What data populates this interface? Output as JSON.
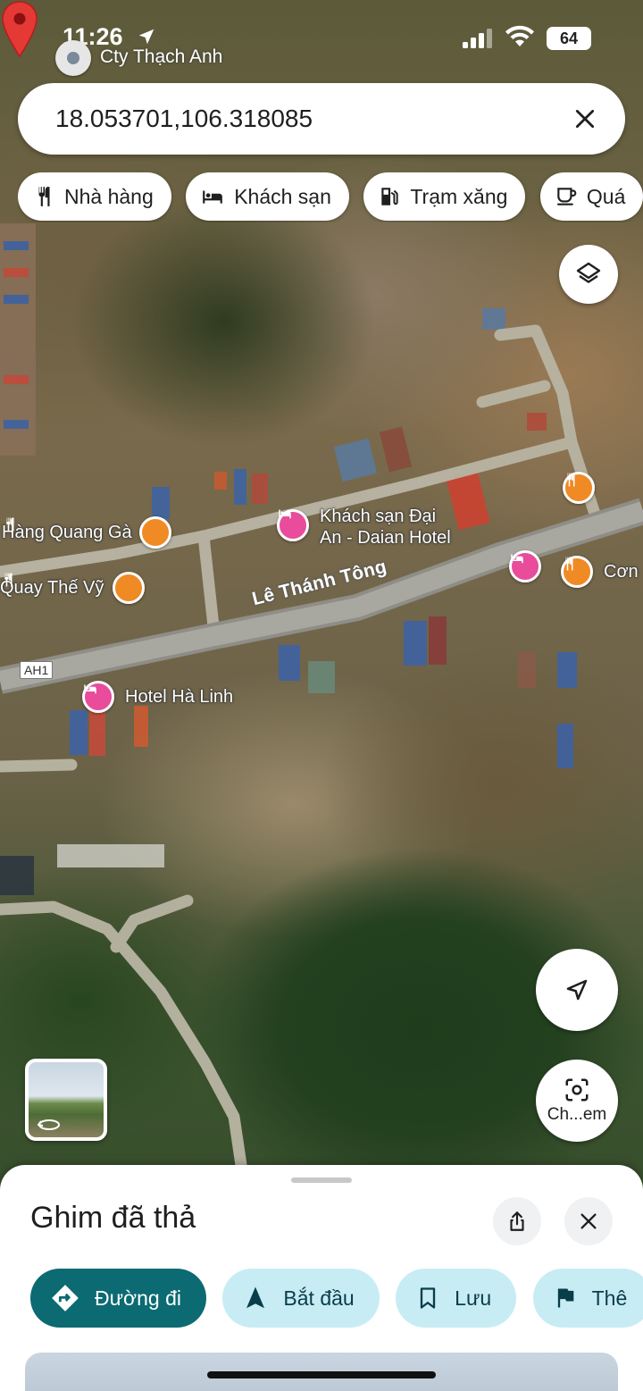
{
  "status_bar": {
    "time": "11:26",
    "carrier": "Cty Thạch Anh",
    "battery": "64"
  },
  "search": {
    "query": "18.053701,106.318085"
  },
  "chips": [
    {
      "label": "Nhà hàng",
      "icon": "restaurant-icon"
    },
    {
      "label": "Khách sạn",
      "icon": "hotel-icon"
    },
    {
      "label": "Trạm xăng",
      "icon": "gas-station-icon"
    },
    {
      "label": "Quá",
      "icon": "cafe-icon"
    }
  ],
  "map": {
    "road_name": "Lê Thánh Tông",
    "highway_shield": "AH1",
    "pois": [
      {
        "label": "Hàng Quang Gà",
        "type": "food"
      },
      {
        "label": "Khách sạn Đại\nAn - Daian Hotel",
        "type": "hotel"
      },
      {
        "label": "Quay Thế Vỹ",
        "type": "food"
      },
      {
        "label": "Cơn",
        "type": "food"
      },
      {
        "label": "Hotel Hà Linh",
        "type": "hotel"
      }
    ],
    "lens_label": "Ch...em"
  },
  "sheet": {
    "title": "Ghim đã thả",
    "actions": [
      {
        "label": "Đường đi",
        "icon": "directions-icon",
        "style": "primary"
      },
      {
        "label": "Bắt đầu",
        "icon": "navigation-start-icon",
        "style": "secondary"
      },
      {
        "label": "Lưu",
        "icon": "bookmark-icon",
        "style": "secondary"
      },
      {
        "label": "Thê",
        "icon": "flag-icon",
        "style": "secondary"
      }
    ]
  },
  "colors": {
    "primary_action": "#0b6a72",
    "secondary_action": "#c7ecf4",
    "pin_red": "#e53935",
    "food_poi": "#f08a24",
    "hotel_poi": "#e84c9a"
  }
}
